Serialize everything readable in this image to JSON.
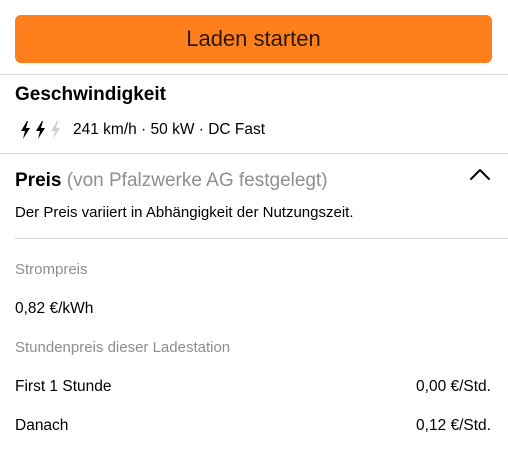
{
  "start_button": {
    "label": "Laden starten"
  },
  "speed": {
    "title": "Geschwindigkeit",
    "level": {
      "filled": 2,
      "total": 3
    },
    "detail": "241 km/h · 50 kW · DC Fast"
  },
  "price": {
    "title": "Preis",
    "provider_note": "(von Pfalzwerke AG festgelegt)",
    "description": "Der Preis variiert in Abhängigkeit der Nutzungszeit.",
    "expanded_icon": "chevron-up-icon"
  },
  "energy_price": {
    "label": "Strompreis",
    "value": "0,82 €/kWh"
  },
  "hourly_price": {
    "label": "Stundenpreis dieser Ladestation",
    "rows": [
      {
        "label": "First 1 Stunde",
        "value": "0,00 €/Std."
      },
      {
        "label": "Danach",
        "value": "0,12 €/Std."
      }
    ]
  },
  "colors": {
    "accent": "#fe7f1c",
    "muted_text": "#8e8e93",
    "divider": "#d9d9d9",
    "bolt_inactive": "#d0d0d0"
  }
}
